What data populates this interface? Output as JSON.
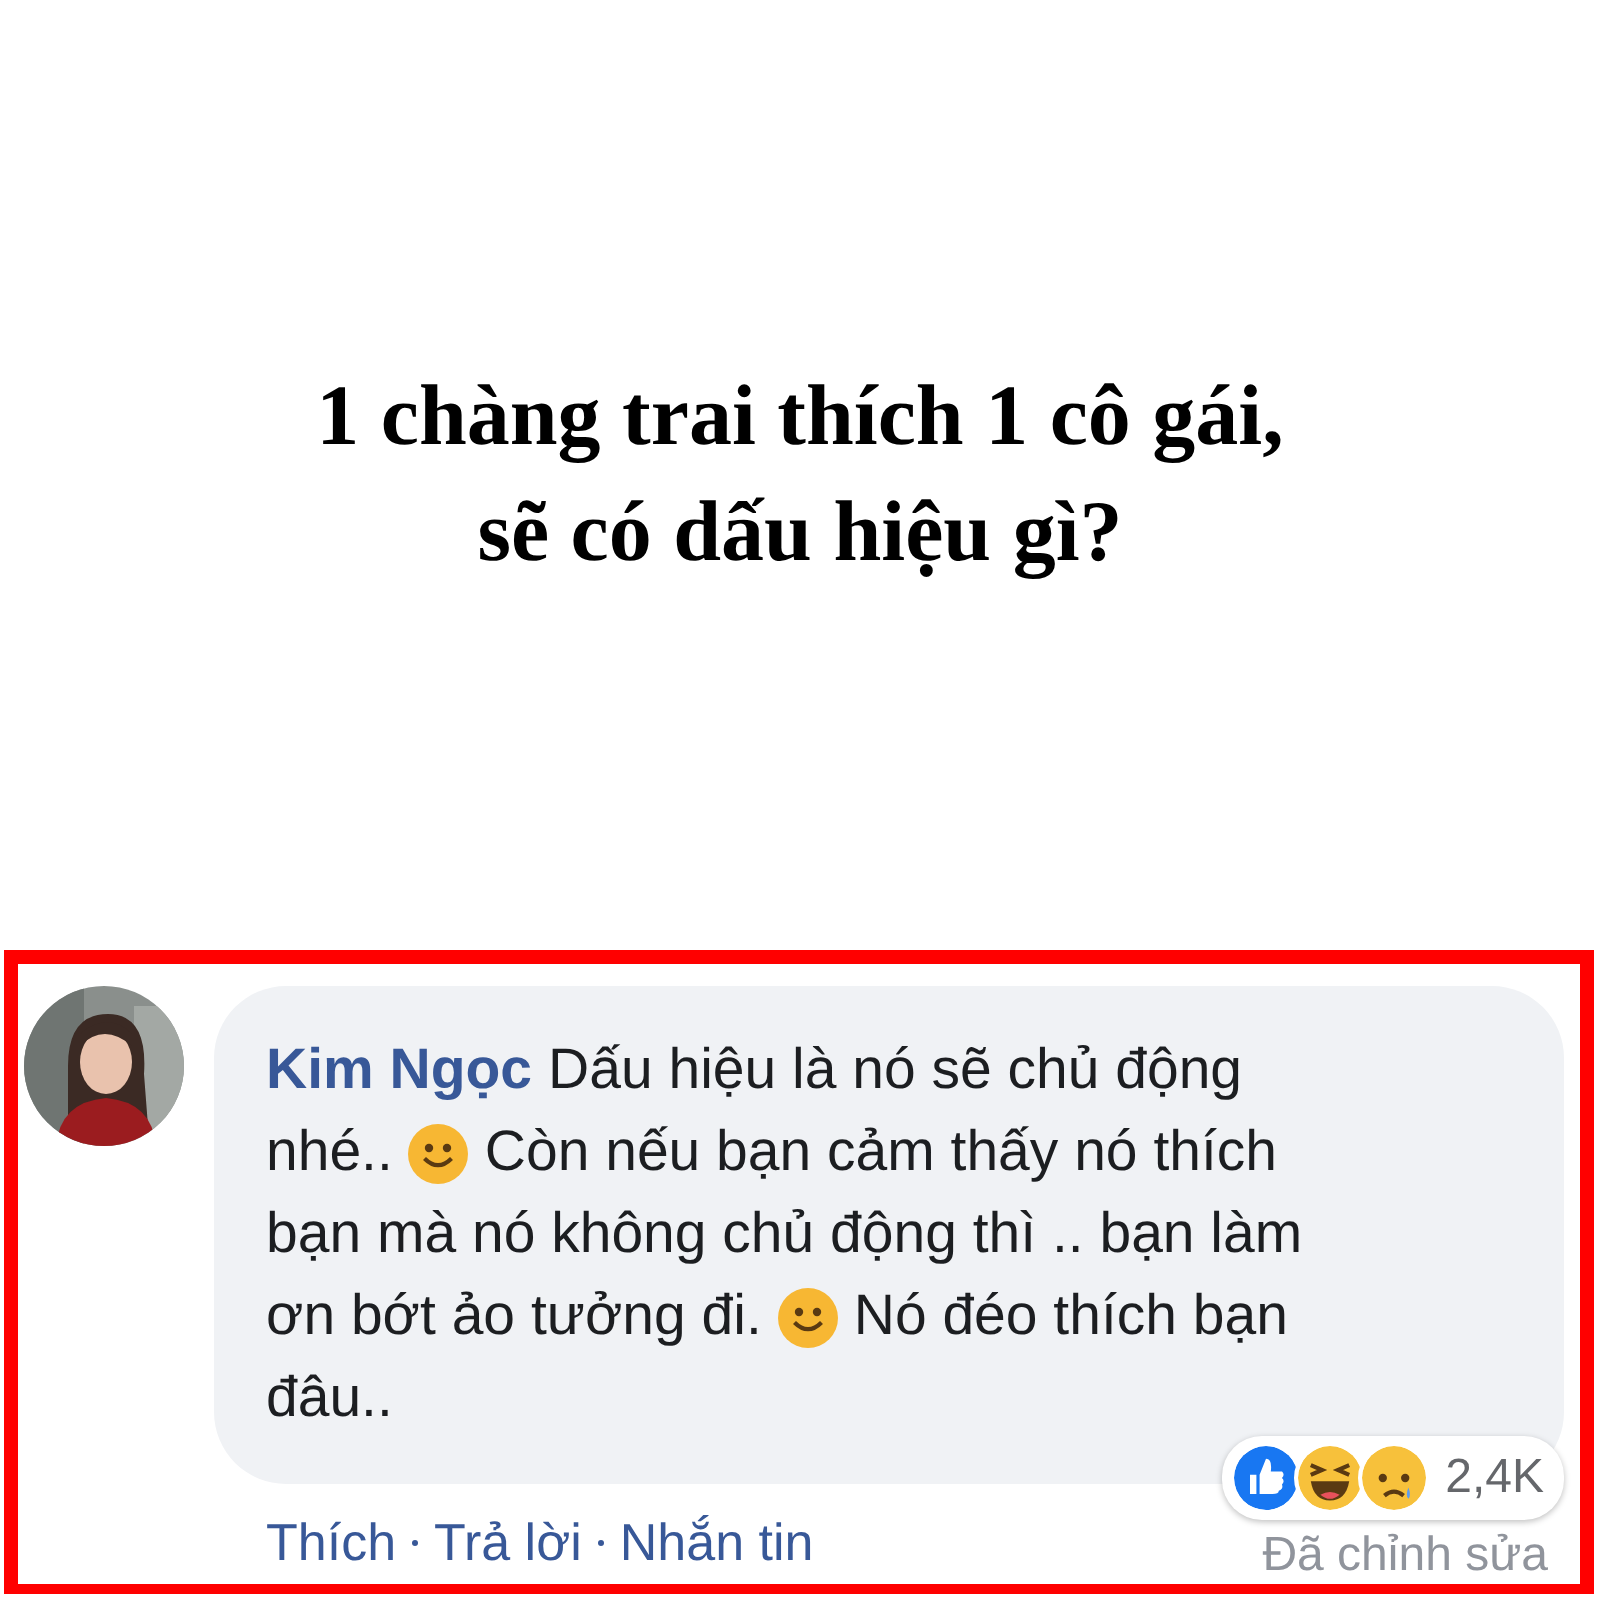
{
  "headline": "1 chàng trai thích 1 cô gái,\nsẽ có dấu hiệu gì?",
  "comment": {
    "author": "Kim Ngọc",
    "lines": [
      [
        {
          "kind": "text",
          "text": "Dấu hiệu là nó sẽ chủ động"
        }
      ],
      [
        {
          "kind": "text",
          "text": "nhé.."
        },
        {
          "kind": "emoji"
        },
        {
          "kind": "text",
          "text": "Còn nếu bạn cảm thấy nó thích"
        }
      ],
      [
        {
          "kind": "text",
          "text": "bạn mà nó không chủ động thì .. bạn làm"
        }
      ],
      [
        {
          "kind": "text",
          "text": "ơn bớt ảo tưởng đi."
        },
        {
          "kind": "emoji"
        },
        {
          "kind": "text",
          "text": "Nó đéo thích bạn"
        }
      ],
      [
        {
          "kind": "text",
          "text": "đâu.."
        }
      ]
    ],
    "actions": [
      "Thích",
      "Trả lời",
      "Nhắn tin"
    ],
    "edited": "Đã chỉnh sửa",
    "reaction_count": "2,4K"
  }
}
